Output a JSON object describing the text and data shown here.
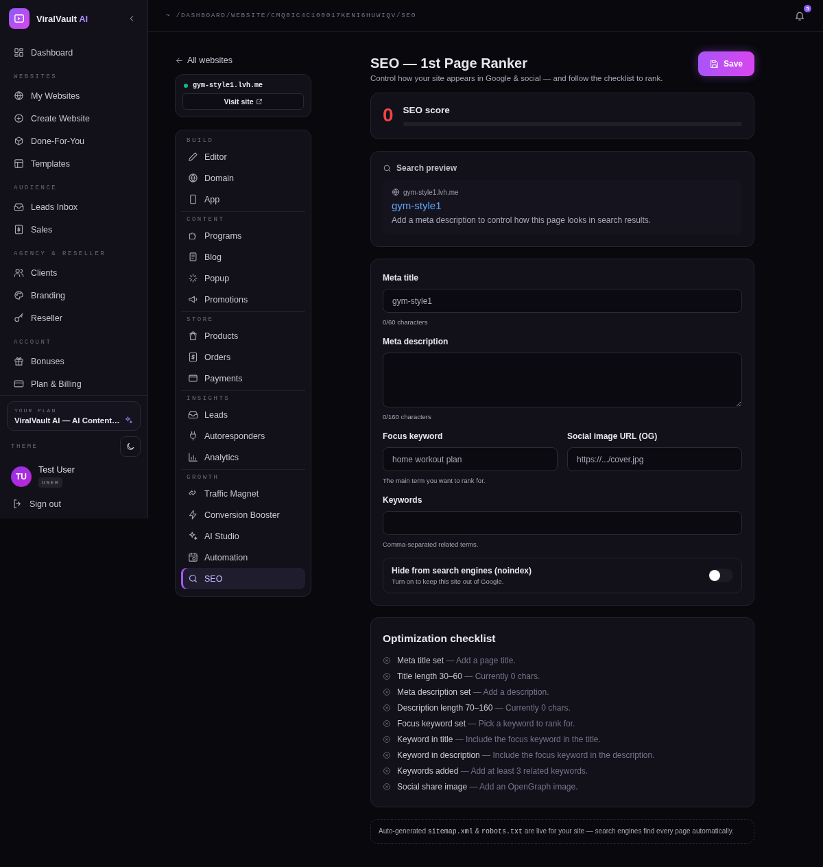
{
  "sidebar": {
    "brand": {
      "name": "ViralVault",
      "suffix": "AI"
    },
    "sections": [
      {
        "items": [
          {
            "label": "Dashboard"
          }
        ]
      },
      {
        "heading": "WEBSITES",
        "items": [
          {
            "label": "My Websites"
          },
          {
            "label": "Create Website"
          },
          {
            "label": "Done-For-You"
          },
          {
            "label": "Templates"
          }
        ]
      },
      {
        "heading": "AUDIENCE",
        "items": [
          {
            "label": "Leads Inbox"
          },
          {
            "label": "Sales"
          }
        ]
      },
      {
        "heading": "AGENCY & RESELLER",
        "items": [
          {
            "label": "Clients"
          },
          {
            "label": "Branding"
          },
          {
            "label": "Reseller"
          }
        ]
      },
      {
        "heading": "ACCOUNT",
        "items": [
          {
            "label": "Bonuses"
          },
          {
            "label": "Plan & Billing"
          }
        ]
      }
    ],
    "plan": {
      "label": "YOUR PLAN",
      "name": "ViralVault AI — AI Content…"
    },
    "theme": {
      "label": "THEME"
    },
    "user": {
      "initials": "TU",
      "name": "Test User",
      "role": "USER"
    },
    "sign_out": "Sign out"
  },
  "topbar": {
    "tilde": "~",
    "path": "/DASHBOARD/WEBSITE/CMQ0IC4C100017KENI6HUWIQV/SEO",
    "notification_count": "5"
  },
  "site": {
    "back": "All websites",
    "domain": "gym-style1.lvh.me",
    "visit": "Visit site",
    "nav": [
      {
        "heading": "BUILD",
        "items": [
          {
            "label": "Editor",
            "selected": false
          },
          {
            "label": "Domain",
            "selected": false
          },
          {
            "label": "App",
            "selected": false
          }
        ]
      },
      {
        "heading": "CONTENT",
        "items": [
          {
            "label": "Programs",
            "selected": false
          },
          {
            "label": "Blog",
            "selected": false
          },
          {
            "label": "Popup",
            "selected": false
          },
          {
            "label": "Promotions",
            "selected": false
          }
        ]
      },
      {
        "heading": "STORE",
        "items": [
          {
            "label": "Products",
            "selected": false
          },
          {
            "label": "Orders",
            "selected": false
          },
          {
            "label": "Payments",
            "selected": false
          }
        ]
      },
      {
        "heading": "INSIGHTS",
        "items": [
          {
            "label": "Leads",
            "selected": false
          },
          {
            "label": "Autoresponders",
            "selected": false
          },
          {
            "label": "Analytics",
            "selected": false
          }
        ]
      },
      {
        "heading": "GROWTH",
        "items": [
          {
            "label": "Traffic Magnet",
            "selected": false
          },
          {
            "label": "Conversion Booster",
            "selected": false
          },
          {
            "label": "AI Studio",
            "selected": false
          },
          {
            "label": "Automation",
            "selected": false
          },
          {
            "label": "SEO",
            "selected": true
          }
        ]
      }
    ]
  },
  "seo": {
    "title": "SEO — 1st Page Ranker",
    "subtitle": "Control how your site appears in Google & social — and follow the checklist to rank.",
    "save": "Save",
    "score": {
      "value": "0",
      "label": "SEO score",
      "level": 0
    },
    "preview": {
      "heading": "Search preview",
      "url": "gym-style1.lvh.me",
      "title": "gym-style1",
      "description": "Add a meta description to control how this page looks in search results."
    },
    "meta_title": {
      "label": "Meta title",
      "placeholder": "gym-style1",
      "counter": "0/60 characters"
    },
    "meta_description": {
      "label": "Meta description",
      "counter": "0/160 characters"
    },
    "focus_keyword": {
      "label": "Focus keyword",
      "placeholder": "home workout plan",
      "hint": "The main term you want to rank for."
    },
    "social_image": {
      "label": "Social image URL (OG)",
      "placeholder": "https://.../cover.jpg"
    },
    "keywords": {
      "label": "Keywords",
      "hint": "Comma-separated related terms."
    },
    "noindex": {
      "label": "Hide from search engines (noindex)",
      "hint": "Turn on to keep this site out of Google.",
      "on": false
    },
    "checklist": {
      "title": "Optimization checklist",
      "items": [
        {
          "label": "Meta title set",
          "hint": "— Add a page title.",
          "done": false
        },
        {
          "label": "Title length 30–60",
          "hint": "— Currently 0 chars.",
          "done": false
        },
        {
          "label": "Meta description set",
          "hint": "— Add a description.",
          "done": false
        },
        {
          "label": "Description length 70–160",
          "hint": "— Currently 0 chars.",
          "done": false
        },
        {
          "label": "Focus keyword set",
          "hint": "— Pick a keyword to rank for.",
          "done": false
        },
        {
          "label": "Keyword in title",
          "hint": "— Include the focus keyword in the title.",
          "done": false
        },
        {
          "label": "Keyword in description",
          "hint": "— Include the focus keyword in the description.",
          "done": false
        },
        {
          "label": "Keywords added",
          "hint": "— Add at least 3 related keywords.",
          "done": false
        },
        {
          "label": "Social share image",
          "hint": "— Add an OpenGraph image.",
          "done": false
        }
      ]
    },
    "footer_note": [
      {
        "kind": "text",
        "text": "Auto-generated "
      },
      {
        "kind": "code",
        "text": "sitemap.xml"
      },
      {
        "kind": "text",
        "text": " & "
      },
      {
        "kind": "code",
        "text": "robots.txt"
      },
      {
        "kind": "text",
        "text": " are live for your site — search engines find every page automatically."
      }
    ]
  }
}
